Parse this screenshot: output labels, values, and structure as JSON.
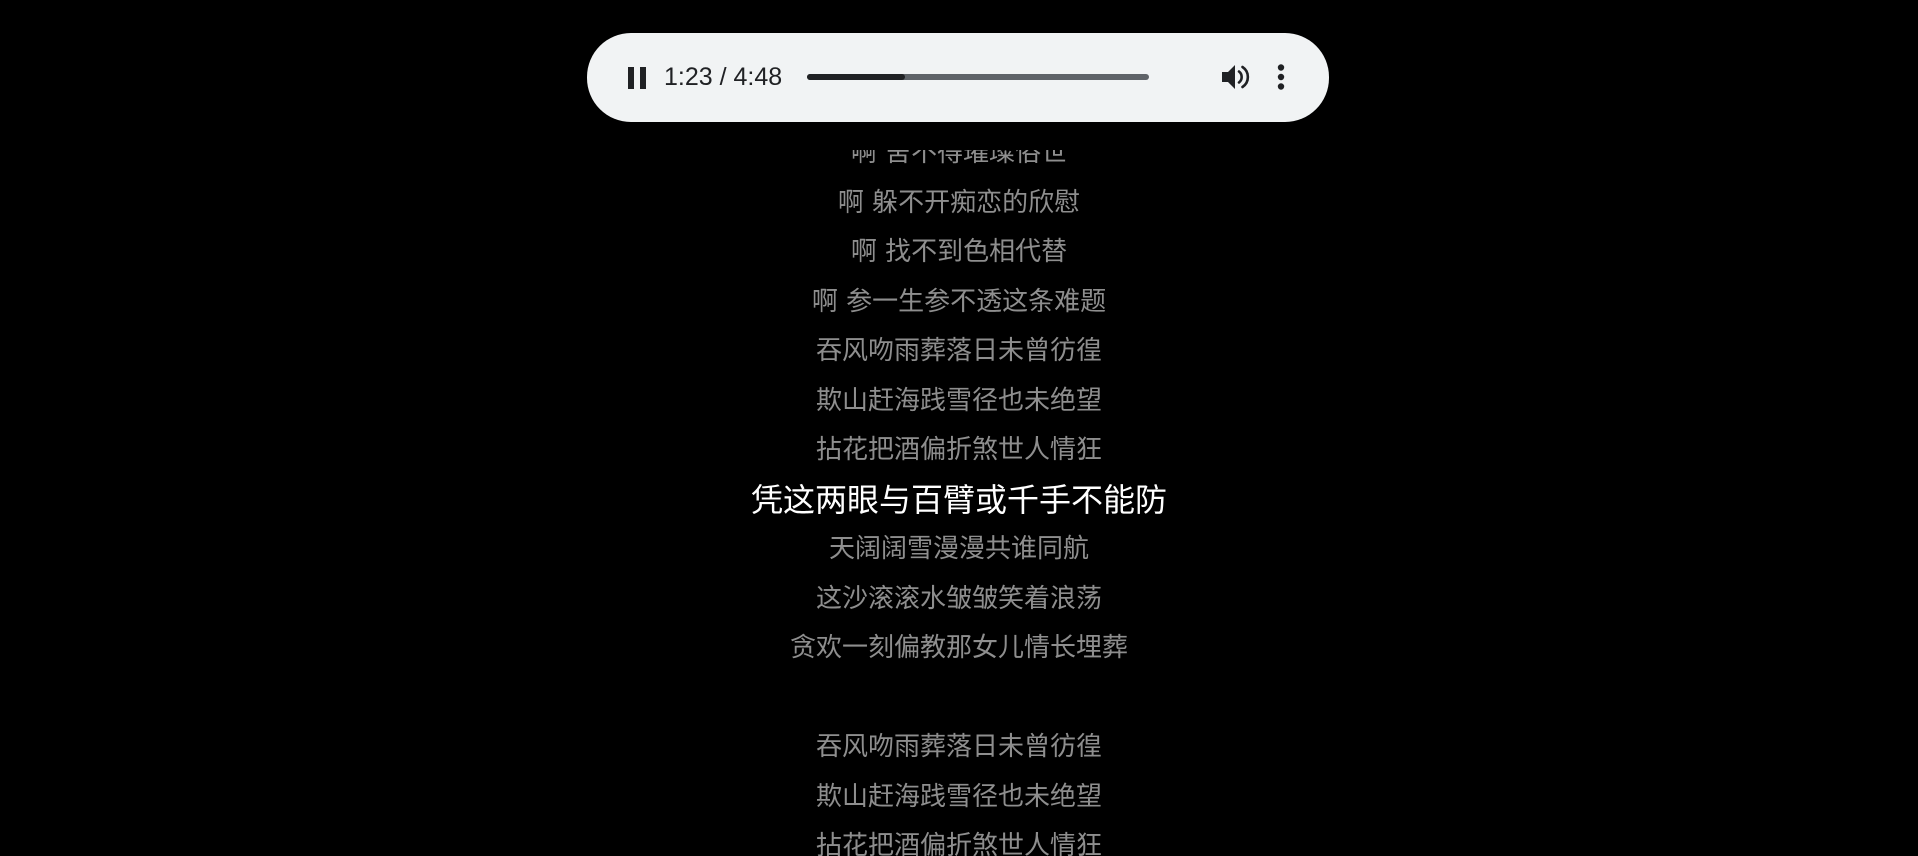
{
  "player": {
    "time_display": "1:23 / 4:48",
    "progress_fraction": 0.288,
    "play_state_icon": "pause-icon",
    "volume_icon": "volume-icon",
    "more_icon": "more-vert-icon",
    "colors": {
      "bar_background": "#f1f3f4",
      "progress_played": "#202124",
      "progress_remaining": "#5f6368"
    }
  },
  "lyrics": {
    "active_index": 7,
    "colors": {
      "active": "#ffffff",
      "inactive": "#8e8e8e",
      "background": "#000000"
    },
    "lines": [
      "啊 舍不得璀璨俗世",
      "啊 躲不开痴恋的欣慰",
      "啊 找不到色相代替",
      "啊 参一生参不透这条难题",
      "吞风吻雨葬落日未曾彷徨",
      "欺山赶海践雪径也未绝望",
      "拈花把酒偏折煞世人情狂",
      "凭这两眼与百臂或千手不能防",
      "天阔阔雪漫漫共谁同航",
      "这沙滚滚水皱皱笑着浪荡",
      "贪欢一刻偏教那女儿情长埋葬",
      "",
      "吞风吻雨葬落日未曾彷徨",
      "欺山赶海践雪径也未绝望",
      "拈花把酒偏折煞世人情狂"
    ]
  }
}
